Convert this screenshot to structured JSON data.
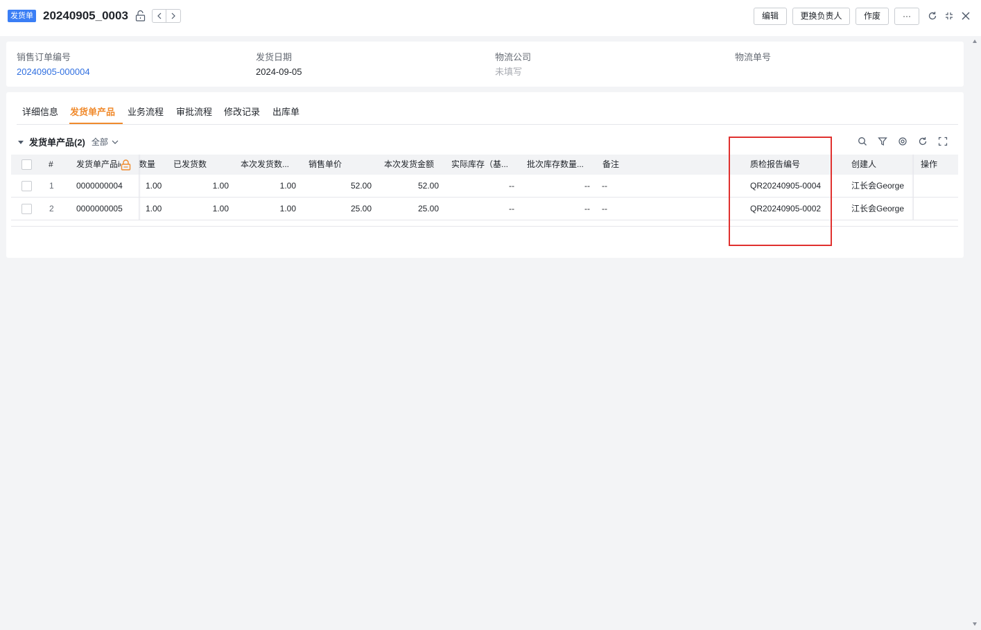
{
  "header": {
    "badge": "发货单",
    "title": "20240905_0003",
    "buttons": {
      "edit": "编辑",
      "change_owner": "更换负责人",
      "void": "作废",
      "more": "···"
    }
  },
  "summary": {
    "fields": [
      {
        "label": "销售订单编号",
        "value": "20240905-000004"
      },
      {
        "label": "发货日期",
        "value": "2024-09-05"
      },
      {
        "label": "物流公司",
        "value": "未填写"
      },
      {
        "label": "物流单号",
        "value": ""
      }
    ]
  },
  "tabs": [
    "详细信息",
    "发货单产品",
    "业务流程",
    "审批流程",
    "修改记录",
    "出库单"
  ],
  "active_tab": "发货单产品",
  "section": {
    "title": "发货单产品(2)",
    "filter": "全部"
  },
  "table": {
    "columns": [
      "#",
      "发货单产品id",
      "数量",
      "已发货数",
      "本次发货数...",
      "销售单价",
      "本次发货金额",
      "实际库存（基...",
      "批次库存数量...",
      "备注",
      "质检报告编号",
      "创建人",
      "操作"
    ],
    "rows": [
      {
        "idx": "1",
        "id": "0000000004",
        "qty": "1.00",
        "shipped": "1.00",
        "this_ship": "1.00",
        "price": "52.00",
        "amount": "52.00",
        "stock": "--",
        "batch": "--",
        "note": "--",
        "qc": "QR20240905-0004",
        "creator": "江长会George"
      },
      {
        "idx": "2",
        "id": "0000000005",
        "qty": "1.00",
        "shipped": "1.00",
        "this_ship": "1.00",
        "price": "25.00",
        "amount": "25.00",
        "stock": "--",
        "batch": "--",
        "note": "--",
        "qc": "QR20240905-0002",
        "creator": "江长会George"
      }
    ]
  },
  "colors": {
    "accent": "#3a7ef5",
    "active_tab": "#f08a2c",
    "link": "#2f6fe0",
    "highlight": "#e0302e"
  }
}
